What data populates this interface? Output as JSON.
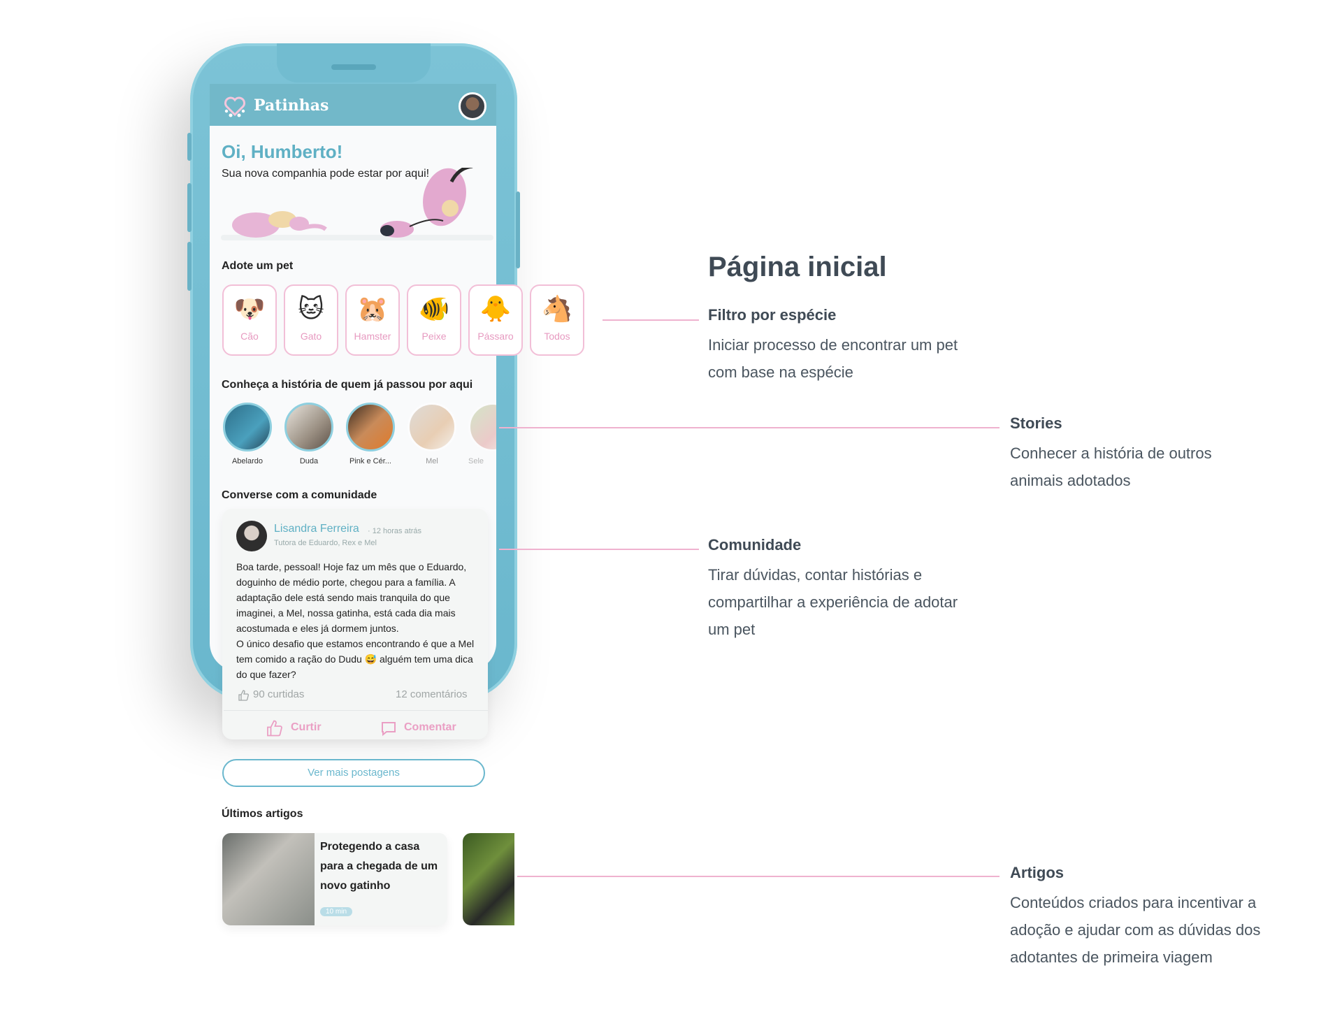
{
  "app": {
    "title": "Patinhas",
    "greeting": "Oi, Humberto!",
    "greeting_sub": "Sua nova companhia pode estar por aqui!"
  },
  "adopt": {
    "title": "Adote um pet",
    "species": [
      {
        "emoji": "🐶",
        "label": "Cão"
      },
      {
        "emoji": "🐱",
        "label": "Gato"
      },
      {
        "emoji": "🐹",
        "label": "Hamster"
      },
      {
        "emoji": "🐠",
        "label": "Peixe"
      },
      {
        "emoji": "🐥",
        "label": "Pássaro"
      },
      {
        "emoji": "🐴",
        "label": "Todos"
      }
    ]
  },
  "stories": {
    "title": "Conheça a história de quem já passou por aqui",
    "items": [
      {
        "name": "Abelardo"
      },
      {
        "name": "Duda"
      },
      {
        "name": "Pink e Cér..."
      },
      {
        "name": "Mel"
      },
      {
        "name": "Sele"
      }
    ]
  },
  "community": {
    "title": "Converse com a comunidade",
    "post": {
      "author": "Lisandra Ferreira",
      "time": "· 12 horas atrás",
      "role": "Tutora de Eduardo, Rex e Mel",
      "body_1": "Boa tarde, pessoal! Hoje faz um mês que o Eduardo, doguinho de médio porte, chegou para a família. A adaptação dele está sendo mais tranquila do que imaginei, a Mel, nossa gatinha, está cada dia mais acostumada e eles já dormem juntos.",
      "body_2": "O único desafio que estamos encontrando é que a Mel tem comido a ração do Dudu 😅 alguém tem uma dica do que fazer?",
      "likes": "90 curtidas",
      "comments": "12 comentários",
      "like_label": "Curtir",
      "comment_label": "Comentar"
    },
    "more_button": "Ver mais postagens"
  },
  "articles": {
    "title": "Últimos artigos",
    "items": [
      {
        "title": "Protegendo a casa para a chegada de um novo gatinho",
        "badge": "10 min"
      }
    ]
  },
  "annotations": {
    "main_title": "Página inicial",
    "filter_title": "Filtro por espécie",
    "filter_text_1": "Iniciar processo de encontrar um pet",
    "filter_text_2": "com base na espécie",
    "stories_title": "Stories",
    "stories_text_1": "Conhecer a história de outros",
    "stories_text_2": "animais adotados",
    "community_title": "Comunidade",
    "community_text_1": "Tirar dúvidas, contar histórias e",
    "community_text_2": "compartilhar a experiência de adotar",
    "community_text_3": "um pet",
    "articles_title": "Artigos",
    "articles_text_1": "Conteúdos criados para incentivar a",
    "articles_text_2": "adoção e ajudar com as dúvidas dos",
    "articles_text_3": "adotantes de primeira viagem"
  },
  "colors": {
    "accent": "#6ab7cd",
    "pink": "#ea9fc4",
    "annotation_text": "#3f4a55"
  }
}
